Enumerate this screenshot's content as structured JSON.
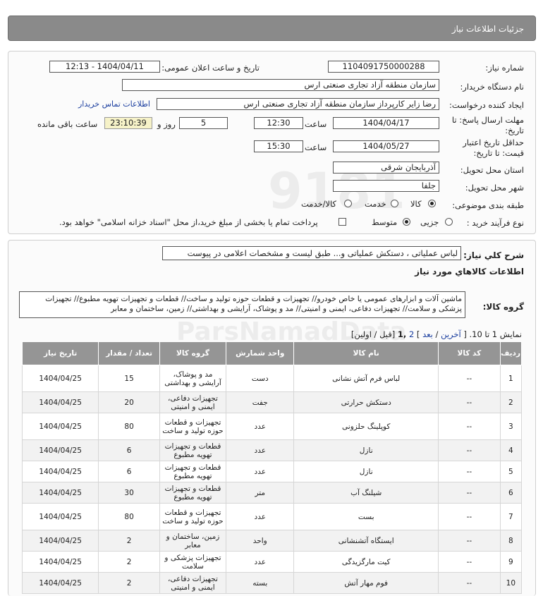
{
  "header": {
    "title": "جزئیات اطلاعات نیاز"
  },
  "info": {
    "need_number_label": "شماره نیاز:",
    "need_number": "1104091750000288",
    "announce_label": "تاریخ و ساعت اعلان عمومی:",
    "announce_value": "1404/04/11 - 12:13",
    "buyer_label": "نام دستگاه خریدار:",
    "buyer_value": "سازمان منطقه آزاد تجاری صنعتی ارس",
    "creator_label": "ایجاد کننده درخواست:",
    "creator_value": "رضا زایر کارپرداز سازمان منطقه آزاد تجاری صنعتی ارس",
    "contact_link": "اطلاعات تماس خریدار",
    "deadline_label_1": "مهلت ارسال پاسخ: تا",
    "deadline_label_2": "تاریخ:",
    "deadline_date": "1404/04/17",
    "time_label": "ساعت",
    "deadline_time": "12:30",
    "days_value": "5",
    "days_label": "روز و",
    "timer_value": "23:10:39",
    "remaining_label": "ساعت باقی مانده",
    "validity_label_1": "حداقل تاریخ اعتبار",
    "validity_label_2": "قیمت: تا تاریخ:",
    "validity_date": "1404/05/27",
    "validity_time": "15:30",
    "province_label": "استان محل تحویل:",
    "province_value": "آذربایجان شرقی",
    "city_label": "شهر محل تحویل:",
    "city_value": "جلفا",
    "category_label": "طبقه بندی موضوعی:",
    "category_options": [
      "کالا",
      "خدمت",
      "کالا/خدمت"
    ],
    "category_selected": "کالا",
    "process_label": "نوع فرآیند خرید :",
    "process_options": [
      "جزیی",
      "متوسط"
    ],
    "process_selected": "متوسط",
    "payment_note": "پرداخت تمام یا بخشی از مبلغ خرید،از محل \"اسناد خزانه اسلامی\" خواهد بود."
  },
  "description": {
    "label": "شرح کلي نياز:",
    "value": "لباس عملیاتی ، دستکش عملیاتی و... طبق لیست و مشخصات اعلامی در پیوست"
  },
  "goods_section": {
    "title": "اطلاعات کالاهاي مورد نياز",
    "group_label": "گروه کالا:",
    "group_value": "ماشین آلات و ابزارهای عمومی یا خاص خودرو// تجهیزات و قطعات حوزه تولید و ساخت// قطعات و تجهیزات تهویه مطبوع// تجهیزات پزشکی و سلامت// تجهیزات دفاعی، ایمنی و امنیتی// مد و پوشاک، آرایشی و بهداشتی// زمین، ساختمان و معابر"
  },
  "pagination": {
    "showing": "نمایش 1 تا 10.",
    "last": "آخرین",
    "next": "بعد",
    "page2": "2",
    "page1": "1",
    "prev_first": "[قبل / اولین]"
  },
  "table": {
    "headers": [
      "ردیف",
      "کد کالا",
      "نام کالا",
      "واحد شمارش",
      "گروه کالا",
      "تعداد / مقدار",
      "تاریخ نیاز"
    ],
    "rows": [
      [
        "1",
        "--",
        "لباس فرم آتش نشانی",
        "دست",
        "مد و پوشاک، آرایشی و بهداشتی",
        "15",
        "1404/04/25"
      ],
      [
        "2",
        "--",
        "دستکش حرارتی",
        "جفت",
        "تجهیزات دفاعی، ایمنی و امنیتی",
        "20",
        "1404/04/25"
      ],
      [
        "3",
        "--",
        "کوپلینگ حلزونی",
        "عدد",
        "تجهیزات و قطعات حوزه تولید و ساخت",
        "80",
        "1404/04/25"
      ],
      [
        "4",
        "--",
        "نازل",
        "عدد",
        "قطعات و تجهیزات تهویه مطبوع",
        "6",
        "1404/04/25"
      ],
      [
        "5",
        "--",
        "نازل",
        "عدد",
        "قطعات و تجهیزات تهویه مطبوع",
        "6",
        "1404/04/25"
      ],
      [
        "6",
        "--",
        "شیلنگ آب",
        "متر",
        "قطعات و تجهیزات تهویه مطبوع",
        "30",
        "1404/04/25"
      ],
      [
        "7",
        "--",
        "بست",
        "عدد",
        "تجهیزات و قطعات حوزه تولید و ساخت",
        "80",
        "1404/04/25"
      ],
      [
        "8",
        "--",
        "ایستگاه آتشنشانی",
        "واحد",
        "زمین، ساختمان و معابر",
        "2",
        "1404/04/25"
      ],
      [
        "9",
        "--",
        "کیت مارگزیدگی",
        "عدد",
        "تجهیزات پزشکی و سلامت",
        "2",
        "1404/04/25"
      ],
      [
        "10",
        "--",
        "فوم مهار آتش",
        "بسته",
        "تجهیزات دفاعی، ایمنی و امنیتی",
        "2",
        "1404/04/25"
      ]
    ]
  }
}
